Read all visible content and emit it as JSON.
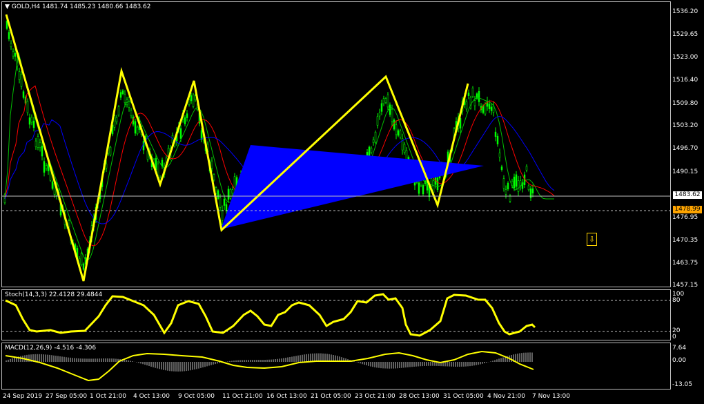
{
  "chart_header": {
    "menu_icon": "triangle-down-icon",
    "symbol": "GOLD,H4",
    "ohlc": "1481.74 1485.23 1480.66 1483.62"
  },
  "price_scale": [
    "1536.20",
    "1529.65",
    "1523.00",
    "1516.40",
    "1509.80",
    "1503.20",
    "1496.70",
    "1490.15",
    "1476.95",
    "1470.35",
    "1463.75",
    "1457.15"
  ],
  "current_price": "1483.62",
  "marker_price": "1478.99",
  "stoch": {
    "title": "Stoch(14,3,3) 22.4128 29.4844",
    "scale": [
      "100",
      "80",
      "20",
      "0"
    ]
  },
  "macd": {
    "title": "MACD(12,26,9) -4.516 -4.306",
    "scale": [
      "7.64",
      "0.00",
      "-13.05"
    ]
  },
  "time_labels": [
    "24 Sep 2019",
    "27 Sep 05:00",
    "1 Oct 21:00",
    "4 Oct 13:00",
    "9 Oct 05:00",
    "11 Oct 21:00",
    "16 Oct 13:00",
    "21 Oct 05:00",
    "23 Oct 21:00",
    "28 Oct 13:00",
    "31 Oct 05:00",
    "4 Nov 21:00",
    "7 Nov 13:00"
  ],
  "colors": {
    "background": "#000000",
    "candles": "#00ff00",
    "zigzag": "#ffff00",
    "triangle": "#0000ff",
    "ma_fast": "#00c000",
    "ma_mid": "#ff0000",
    "ma_slow": "#0000ff",
    "stoch_line": "#ffff00",
    "macd_signal": "#ffff00",
    "macd_hist": "#c0c0c0",
    "marker_tag": "#ffa500"
  },
  "sell_arrow": {
    "icon": "down-arrow-icon",
    "glyph": "⇩"
  }
}
